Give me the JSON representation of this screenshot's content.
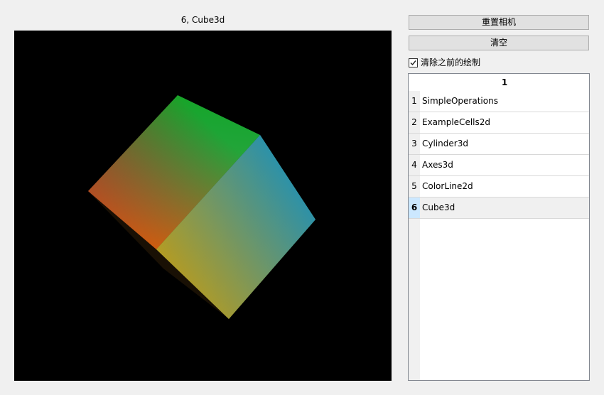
{
  "viewport": {
    "title": "6, Cube3d"
  },
  "controls": {
    "reset_camera_label": "重置相机",
    "clear_label": "清空",
    "clear_previous_label": "清除之前的绘制",
    "clear_previous_checked": true
  },
  "table": {
    "column_header": "1",
    "selected_row": 6,
    "rows": [
      {
        "num": "1",
        "name": "SimpleOperations"
      },
      {
        "num": "2",
        "name": "ExampleCells2d"
      },
      {
        "num": "3",
        "name": "Cylinder3d"
      },
      {
        "num": "4",
        "name": "Axes3d"
      },
      {
        "num": "5",
        "name": "ColorLine2d"
      },
      {
        "num": "6",
        "name": "Cube3d"
      }
    ]
  },
  "cube_colors": {
    "red": "#c0180c",
    "green": "#18a428",
    "cyan": "#16b8ac",
    "blue": "#0e6ed6",
    "yellow": "#b8c00a",
    "orange": "#d88010"
  }
}
